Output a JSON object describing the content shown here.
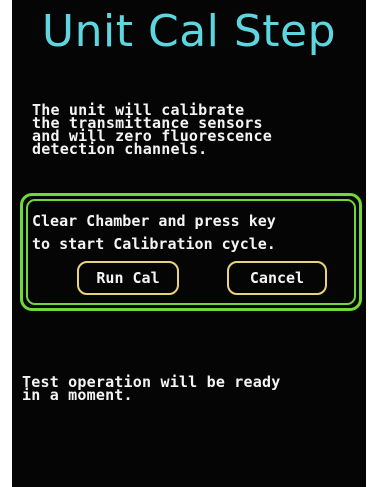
{
  "screen": {
    "title": "Unit Cal Step",
    "info_lines": [
      "The unit will calibrate",
      "the transmittance sensors",
      "and will zero fluorescence",
      "detection channels."
    ],
    "dialog": {
      "prompt_lines": [
        "Clear Chamber and press key",
        "to start Calibration cycle."
      ],
      "run_label": "Run Cal",
      "cancel_label": "Cancel"
    },
    "status_lines": [
      "Test operation will be ready",
      "in a moment."
    ]
  },
  "colors": {
    "title": "#5ed6df",
    "dialog_border": "#6fd83a",
    "button_border": "#e8d27a",
    "text": "#f4f4f4",
    "background": "#050505"
  }
}
